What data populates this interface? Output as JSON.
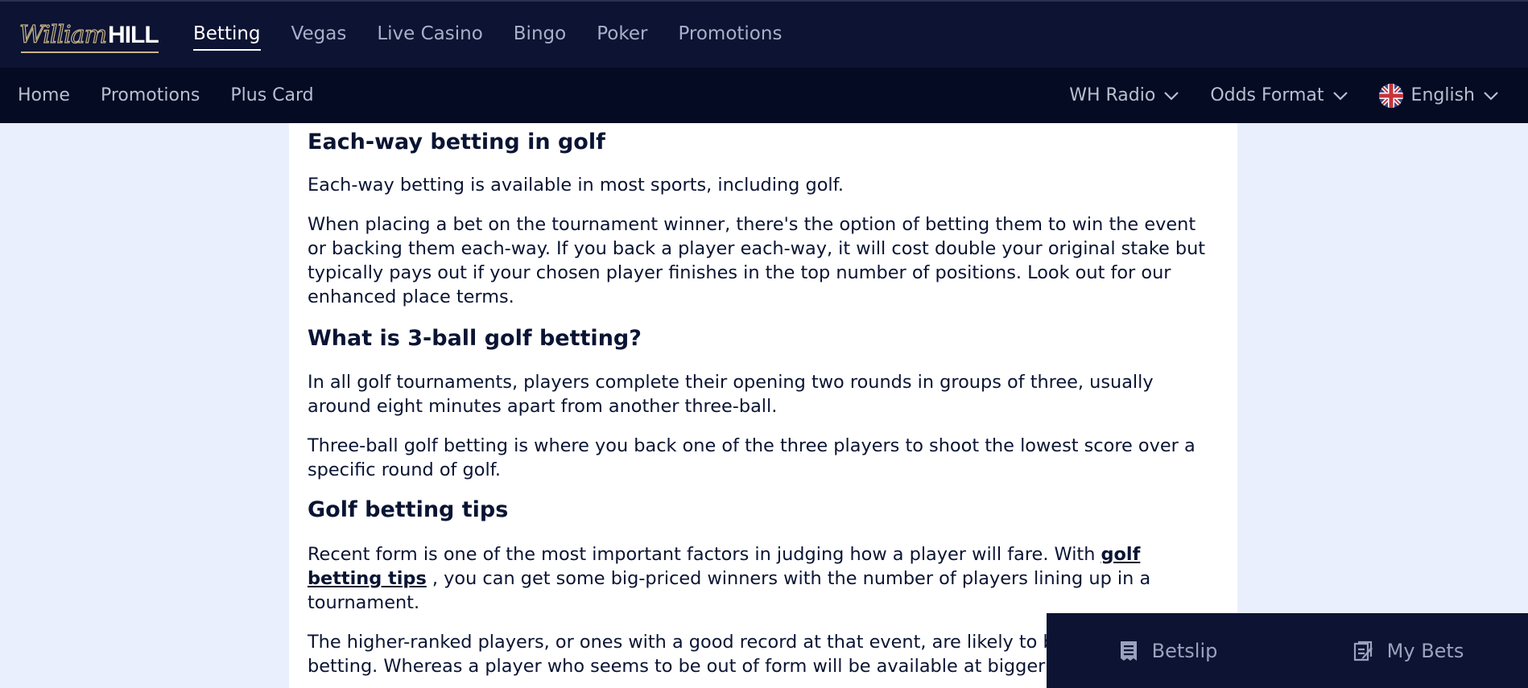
{
  "logo": {
    "script": "William",
    "bold": "HILL"
  },
  "main_nav": [
    "Betting",
    "Vegas",
    "Live Casino",
    "Bingo",
    "Poker",
    "Promotions"
  ],
  "sub_nav": [
    "Home",
    "Promotions",
    "Plus Card"
  ],
  "dropdowns": {
    "radio": "WH Radio",
    "odds": "Odds Format",
    "language": "English"
  },
  "article": {
    "h_each_way": "Each-way betting in golf",
    "p_each_way_1": "Each-way betting is available in most sports, including golf.",
    "p_each_way_2": "When placing a bet on the tournament winner, there's the option of betting them to win the event or backing them each-way. If you back a player each-way, it will cost double your original stake but typically pays out if your chosen player finishes in the top number of positions. Look out for our enhanced place terms.",
    "h_three_ball": "What is 3-ball golf betting?",
    "p_three_ball_1": "In all golf tournaments, players complete their opening two rounds in groups of three, usually around eight minutes apart from another three-ball.",
    "p_three_ball_2": "Three-ball golf betting is where you back one of the three players to shoot the lowest score over a specific round of golf.",
    "h_tips": "Golf betting tips",
    "p_tips_before": "Recent form is one of the most important factors in judging how a player will fare. With ",
    "p_tips_link": "golf betting tips",
    "p_tips_after": " , you can get some big-priced winners with the number of players lining up in a tournament.",
    "p_tips_2": "The higher-ranked players, or ones with a good record at that event, are likely to be at the top of the betting. Whereas a player who seems to be out of form will be available at bigger prices."
  },
  "betbar": {
    "betslip": "Betslip",
    "mybets": "My Bets"
  },
  "colors": {
    "nav_bg": "#0c1333",
    "subnav_bg": "#050b22",
    "page_bg": "#e9effc",
    "logo_gold": "#c8b48a"
  }
}
